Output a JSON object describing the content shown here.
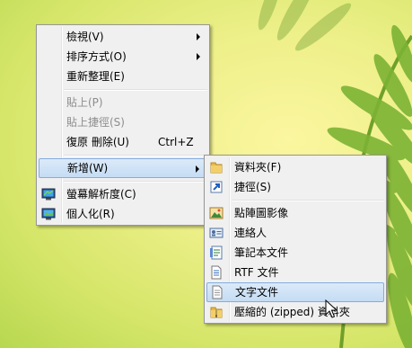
{
  "context_menu": {
    "items": [
      {
        "label": "檢視(V)"
      },
      {
        "label": "排序方式(O)"
      },
      {
        "label": "重新整理(E)"
      },
      {
        "label": "貼上(P)"
      },
      {
        "label": "貼上捷徑(S)"
      },
      {
        "label": "復原 刪除(U)",
        "shortcut": "Ctrl+Z"
      },
      {
        "label": "新增(W)"
      },
      {
        "label": "螢幕解析度(C)",
        "icon": "display-resolution-icon"
      },
      {
        "label": "個人化(R)",
        "icon": "personalize-icon"
      }
    ]
  },
  "new_submenu": {
    "items": [
      {
        "label": "資料夾(F)",
        "icon": "folder-icon"
      },
      {
        "label": "捷徑(S)",
        "icon": "shortcut-icon"
      },
      {
        "label": "點陣圖影像",
        "icon": "bitmap-image-icon"
      },
      {
        "label": "連絡人",
        "icon": "contact-icon"
      },
      {
        "label": "筆記本文件",
        "icon": "journal-document-icon"
      },
      {
        "label": "RTF 文件",
        "icon": "rtf-document-icon"
      },
      {
        "label": "文字文件",
        "icon": "text-document-icon"
      },
      {
        "label": "壓縮的 (zipped) 資料夾",
        "icon": "zip-folder-icon"
      }
    ]
  },
  "colors": {
    "menu_bg": "#f0f0f0",
    "highlight": "#c4dcf4",
    "highlight_border": "#84acdd",
    "disabled_text": "#8d8d8d"
  }
}
